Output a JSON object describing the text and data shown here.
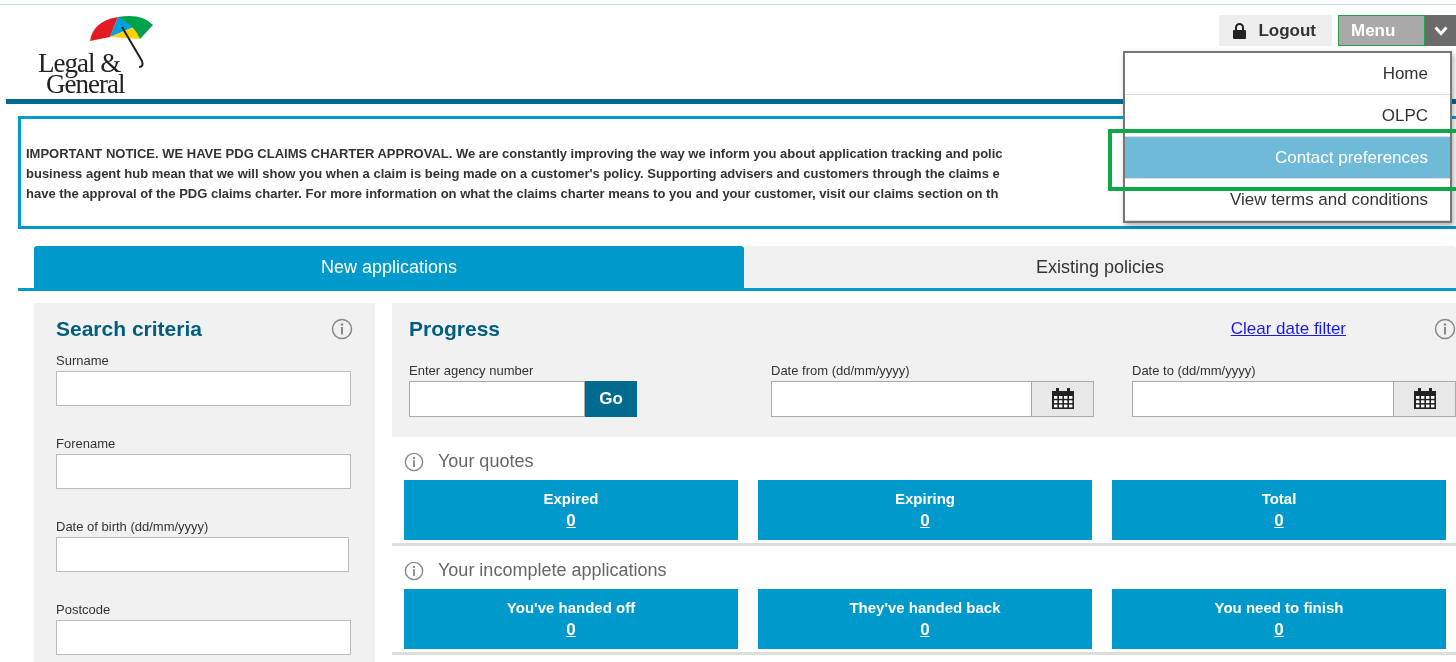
{
  "logo": {
    "lines": [
      "Legal &",
      "General"
    ]
  },
  "header": {
    "logout": "Logout",
    "menu": "Menu"
  },
  "menu_dropdown": {
    "items": [
      {
        "label": "Home",
        "selected": false
      },
      {
        "label": "OLPC",
        "selected": false
      },
      {
        "label": "Contact preferences",
        "selected": true
      },
      {
        "label": "View terms and conditions",
        "selected": false
      }
    ],
    "highlighted": true
  },
  "notice": {
    "lines": [
      "IMPORTANT NOTICE. WE HAVE PDG CLAIMS CHARTER APPROVAL. We are constantly improving the way we inform you about application tracking and polic",
      "business agent hub mean that we will show you when a claim is being made on a customer's policy. Supporting advisers and customers through the claims e",
      "have the approval of the PDG claims charter. For more information on what the claims charter means to you and your customer, visit our claims section on th"
    ]
  },
  "tabs": [
    {
      "label": "New applications",
      "selected": true
    },
    {
      "label": "Existing policies",
      "selected": false
    }
  ],
  "search_criteria": {
    "title": "Search criteria",
    "fields": [
      "Surname",
      "Forename",
      "Date of birth (dd/mm/yyyy)",
      "Postcode"
    ]
  },
  "progress": {
    "title": "Progress",
    "clear_link": "Clear date filter",
    "agency_label": "Enter agency number",
    "go": "Go",
    "date_from": "Date from (dd/mm/yyyy)",
    "date_to": "Date to (dd/mm/yyyy)"
  },
  "sections": [
    {
      "title": "Your quotes",
      "cards": [
        {
          "label": "Expired",
          "count": "0"
        },
        {
          "label": "Expiring",
          "count": "0"
        },
        {
          "label": "Total",
          "count": "0"
        }
      ]
    },
    {
      "title": "Your incomplete applications",
      "cards": [
        {
          "label": "You've handed off",
          "count": "0"
        },
        {
          "label": "They've handed back",
          "count": "0"
        },
        {
          "label": "You need to finish",
          "count": "0"
        }
      ]
    }
  ]
}
